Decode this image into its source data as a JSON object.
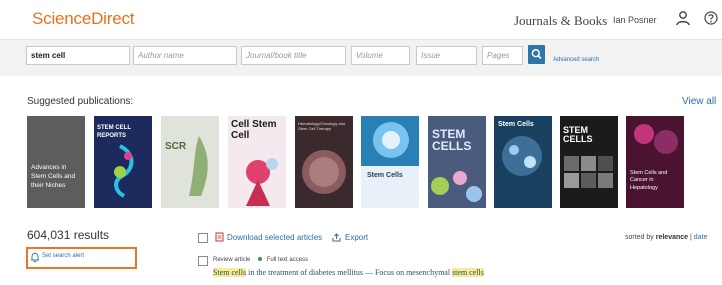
{
  "header": {
    "logo": "ScienceDirect",
    "journals_books": "Journals & Books",
    "user_name": "Ian Posner",
    "user_icon": "user-icon",
    "help_icon": "help-icon"
  },
  "search": {
    "keywords": "stem cell",
    "author_placeholder": "Author name",
    "journal_placeholder": "Journal/book title",
    "volume_placeholder": "Volume",
    "issue_placeholder": "Issue",
    "pages_placeholder": "Pages",
    "search_icon": "search-icon",
    "advanced_label": "Advanced search",
    "accent": "#2d74a8"
  },
  "suggested": {
    "title": "Suggested publications:",
    "view_all": "View all",
    "books": [
      {
        "title": "Advances in Stem Cells and their Niches"
      },
      {
        "title": "STEM CELL REPORTS"
      },
      {
        "title": "SCR"
      },
      {
        "title": "Cell Stem Cell"
      },
      {
        "title": "Hematology/Oncology and Stem Cell Therapy"
      },
      {
        "title": "Stem Cells"
      },
      {
        "title": "STEM CELLS"
      },
      {
        "title": "Stem Cells"
      },
      {
        "title": "STEM CELLS"
      },
      {
        "title": "Stem Cells and Cancer in Hepatology"
      }
    ]
  },
  "results": {
    "count": "604,031 results",
    "alert_label": "Set search alert",
    "alert_icon": "bell-icon",
    "download_label": "Download selected articles",
    "download_icon": "pdf-icon",
    "export_label": "Export",
    "export_icon": "export-icon",
    "sort_label": "sorted by",
    "sort_relevance": "relevance",
    "sort_sep": "|",
    "sort_date": "date",
    "alert_border": "#ec7523"
  },
  "article": {
    "type": "Review article",
    "access": "Full text access",
    "title_pre": "Stem cells",
    "title_mid": " in the treatment of diabetes mellitus — Focus on mesenchymal ",
    "title_hl": "stem cells",
    "access_color": "#3f9b3f"
  }
}
